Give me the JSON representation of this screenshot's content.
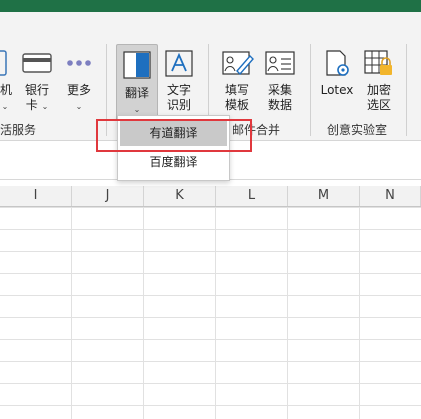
{
  "ribbon": {
    "buttons": {
      "phone": "机",
      "bank_card_line1": "银行",
      "bank_card_line2": "卡",
      "more": "更多",
      "translate": "翻译",
      "ocr_line1": "文字",
      "ocr_line2": "识别",
      "template_line1": "填写",
      "template_line2": "模板",
      "collect_line1": "采集",
      "collect_line2": "数据",
      "lotex": "Lotex",
      "encrypt_line1": "加密",
      "encrypt_line2": "选区"
    },
    "groups": {
      "life": "生活服务",
      "mail": "邮件合并",
      "lab": "创意实验室"
    }
  },
  "dropdown": {
    "items": [
      "有道翻译",
      "百度翻译"
    ],
    "highlighted": "有道翻译"
  },
  "sheet": {
    "columns": [
      "I",
      "J",
      "K",
      "L",
      "M",
      "N"
    ]
  },
  "colors": {
    "accent_green": "#1f7146",
    "highlight_red": "#e0383d",
    "translate_blue": "#1e6fbf"
  }
}
